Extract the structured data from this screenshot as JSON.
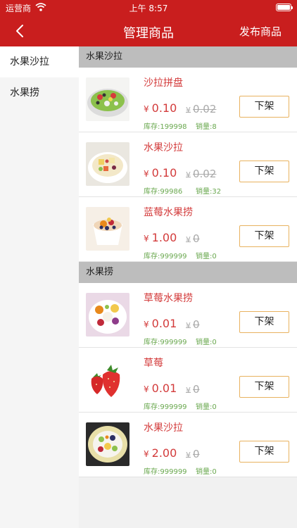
{
  "status_bar": {
    "carrier": "运营商",
    "time": "上午 8:57"
  },
  "nav": {
    "title": "管理商品",
    "action": "发布商品"
  },
  "sidebar": {
    "items": [
      {
        "label": "水果沙拉"
      },
      {
        "label": "水果捞"
      }
    ]
  },
  "sections": [
    {
      "title": "水果沙拉",
      "products": [
        {
          "name": "沙拉拼盘",
          "currency": "¥",
          "price": "0.10",
          "original_price": "0.02",
          "stock": "库存:199998",
          "sales": "销量:8",
          "button": "下架",
          "image": "salad-plate"
        },
        {
          "name": "水果沙拉",
          "currency": "¥",
          "price": "0.10",
          "original_price": "0.02",
          "stock": "库存:99986",
          "sales": "销量:32",
          "button": "下架",
          "image": "fruit-salad-bowl"
        },
        {
          "name": "蓝莓水果捞",
          "currency": "¥",
          "price": "1.00",
          "original_price": "0",
          "stock": "库存:999999",
          "sales": "销量:0",
          "button": "下架",
          "image": "blueberry-fruit-cup"
        }
      ]
    },
    {
      "title": "水果捞",
      "products": [
        {
          "name": "草莓水果捞",
          "currency": "¥",
          "price": "0.01",
          "original_price": "0",
          "stock": "库存:999999",
          "sales": "销量:0",
          "button": "下架",
          "image": "strawberry-fruit-mix"
        },
        {
          "name": "草莓",
          "currency": "¥",
          "price": "0.01",
          "original_price": "0",
          "stock": "库存:999999",
          "sales": "销量:0",
          "button": "下架",
          "image": "strawberries"
        },
        {
          "name": "水果沙拉",
          "currency": "¥",
          "price": "2.00",
          "original_price": "0",
          "stock": "库存:999999",
          "sales": "销量:0",
          "button": "下架",
          "image": "fruit-salad-dish"
        }
      ]
    }
  ],
  "colors": {
    "brand": "#c91e1e",
    "price": "#d33b3b",
    "meta": "#6aa84f",
    "button_border": "#e8b25f"
  }
}
